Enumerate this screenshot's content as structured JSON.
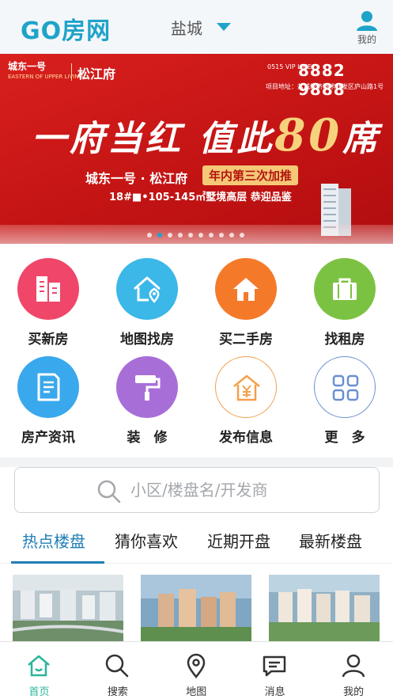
{
  "header": {
    "logo": "GO房网",
    "city": "盐城",
    "me_label": "我的"
  },
  "banner": {
    "brand": "城东一号",
    "brand_sub": "EASTERN OF UPPER LIVING",
    "project": "松江府",
    "phone_prefix": "0515 VIP LINE",
    "phone": "8882 9888",
    "address": "项目地址：盐城经济技术开发区庐山路1号",
    "slogan": "一府当红 值此",
    "slogan_num": "80",
    "slogan_end": "席",
    "line2": "城东一号 · 松江府",
    "tag": "年内第三次加推",
    "line3": "18#■•105-145㎡墅境高层 恭迎品鉴",
    "slide_count": 10,
    "active_slide": 1
  },
  "categories": [
    {
      "label": "买新房",
      "icon": "building-icon",
      "color": "#f0466a"
    },
    {
      "label": "地图找房",
      "icon": "map-house-icon",
      "color": "#3bb7e8"
    },
    {
      "label": "买二手房",
      "icon": "house-icon",
      "color": "#f47a2a"
    },
    {
      "label": "找租房",
      "icon": "bag-icon",
      "color": "#7cc242"
    },
    {
      "label": "房产资讯",
      "icon": "document-icon",
      "color": "#3aa8ec"
    },
    {
      "label": "装　修",
      "icon": "paint-roller-icon",
      "color": "#a86ed8"
    },
    {
      "label": "发布信息",
      "icon": "yuan-house-icon",
      "color": "#f4a04c"
    },
    {
      "label": "更　多",
      "icon": "grid-icon",
      "color": "#6a8fd0"
    }
  ],
  "search": {
    "placeholder": "小区/楼盘名/开发商"
  },
  "tabs": [
    {
      "label": "热点楼盘",
      "active": true
    },
    {
      "label": "猜你喜欢",
      "active": false
    },
    {
      "label": "近期开盘",
      "active": false
    },
    {
      "label": "最新楼盘",
      "active": false
    }
  ],
  "bottom_nav": [
    {
      "label": "首页",
      "icon": "home-icon",
      "active": true
    },
    {
      "label": "搜索",
      "icon": "search-icon",
      "active": false
    },
    {
      "label": "地图",
      "icon": "location-pin-icon",
      "active": false
    },
    {
      "label": "消息",
      "icon": "message-icon",
      "active": false
    },
    {
      "label": "我的",
      "icon": "user-icon",
      "active": false
    }
  ],
  "colors": {
    "brand": "#1fa3c9",
    "tab_active": "#1f7eb5",
    "nav_active": "#2bb59a",
    "banner_red": "#c41414"
  }
}
